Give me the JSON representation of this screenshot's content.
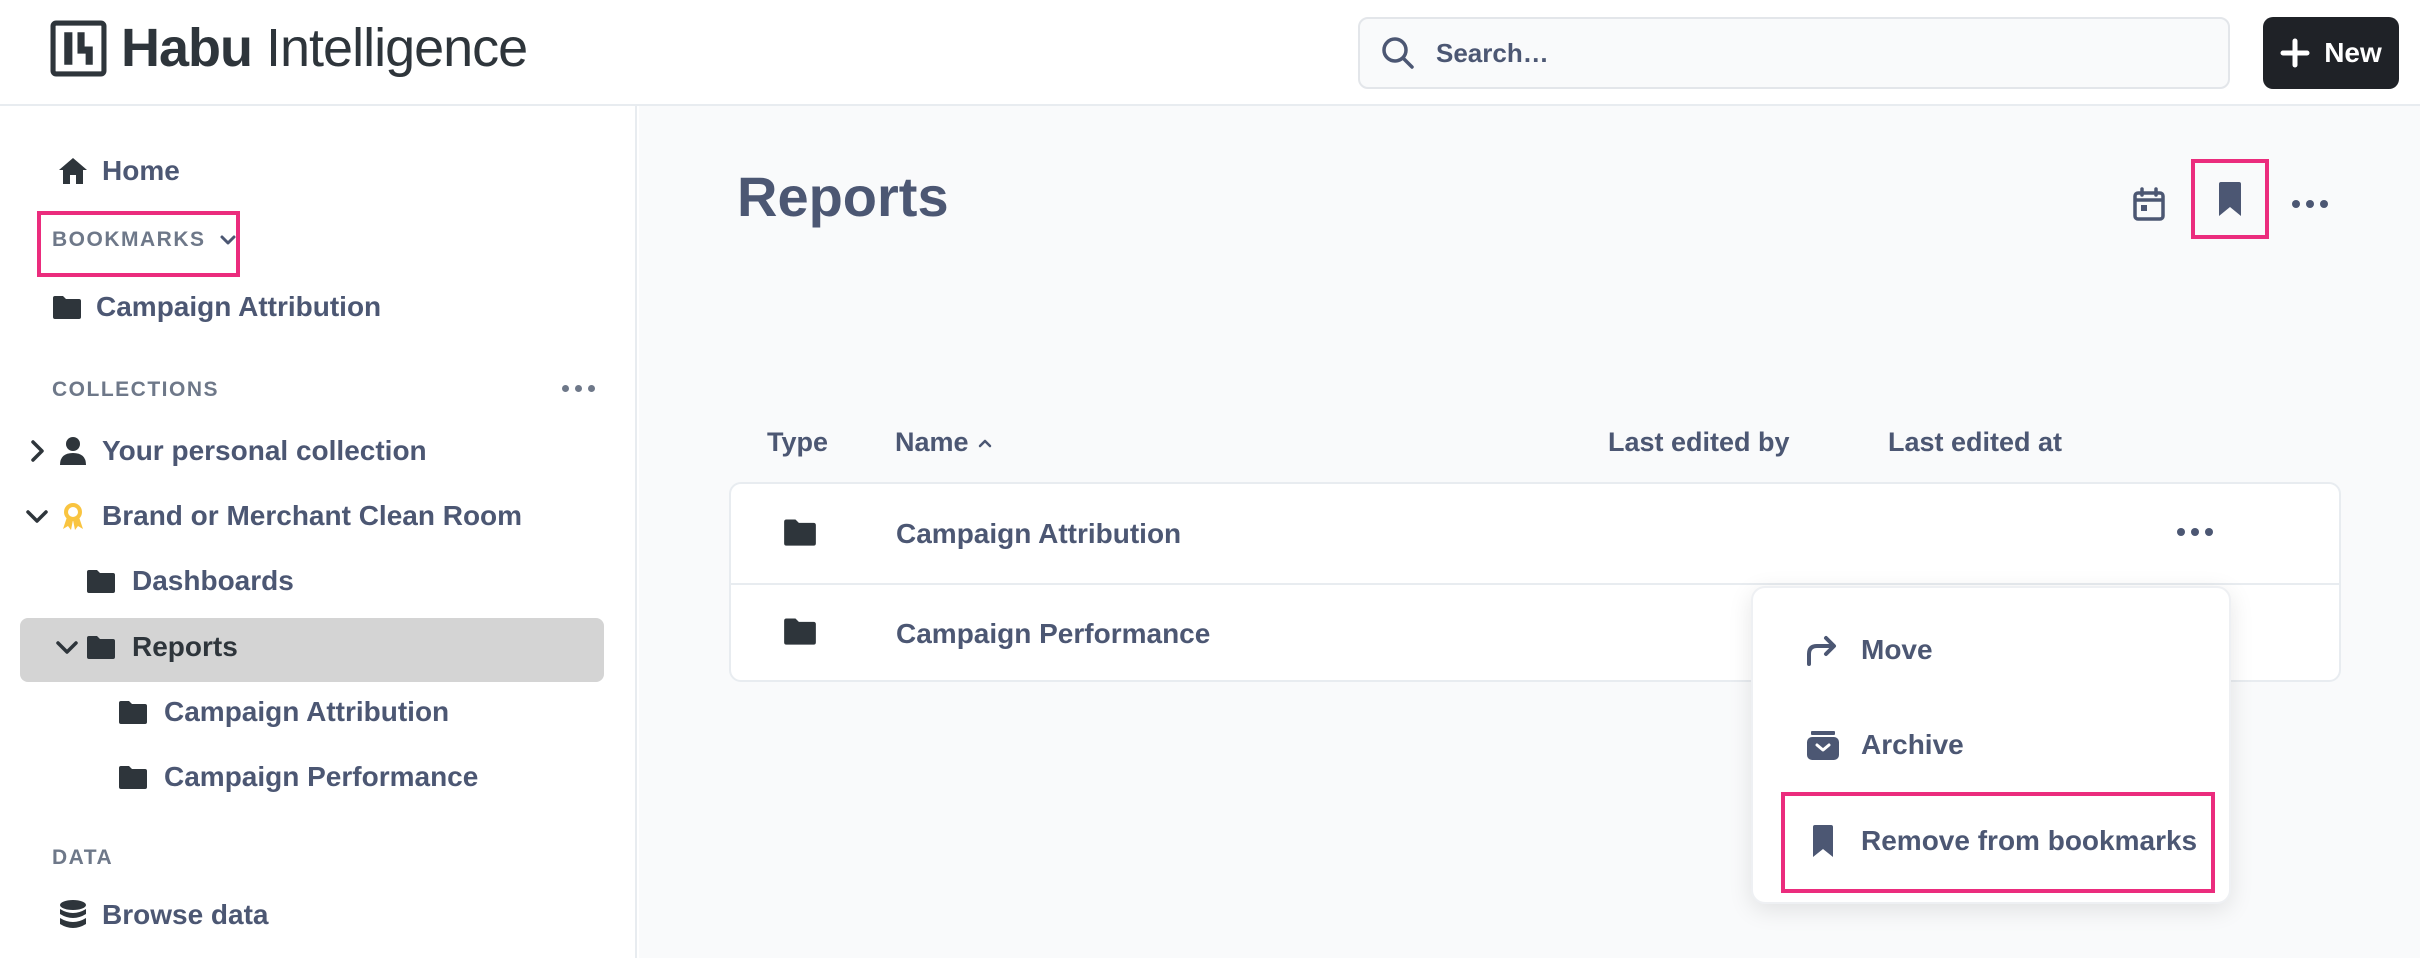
{
  "app": {
    "brand_bold": "Habu",
    "brand_regular": " Intelligence"
  },
  "search": {
    "placeholder": "Search…"
  },
  "header": {
    "new_label": "New"
  },
  "sidebar": {
    "home_label": "Home",
    "bookmarks_label": "BOOKMARKS",
    "bookmarks": [
      {
        "label": "Campaign Attribution"
      }
    ],
    "collections_label": "COLLECTIONS",
    "collections": {
      "personal": "Your personal collection",
      "clean_room": "Brand or Merchant Clean Room",
      "dashboards": "Dashboards",
      "reports": "Reports",
      "report_children": [
        "Campaign Attribution",
        "Campaign Performance"
      ]
    },
    "data_label": "DATA",
    "browse_data_label": "Browse data"
  },
  "main": {
    "title": "Reports",
    "columns": [
      "Type",
      "Name",
      "Last edited by",
      "Last edited at"
    ],
    "sort_indicator": "^",
    "rows": [
      {
        "type": "folder",
        "name": "Campaign Attribution"
      },
      {
        "type": "folder",
        "name": "Campaign Performance"
      }
    ]
  },
  "context_menu": {
    "items": [
      {
        "label": "Move",
        "icon": "move-arrow-icon"
      },
      {
        "label": "Archive",
        "icon": "archive-icon"
      },
      {
        "label": "Remove from bookmarks",
        "icon": "bookmark-icon"
      }
    ]
  },
  "colors": {
    "text": "#4c5773",
    "highlight": "#eb2c7d",
    "new_button_bg": "#1f2227",
    "selected_row_bg": "#d4d4d4",
    "clean_room_icon": "#f9c440"
  }
}
